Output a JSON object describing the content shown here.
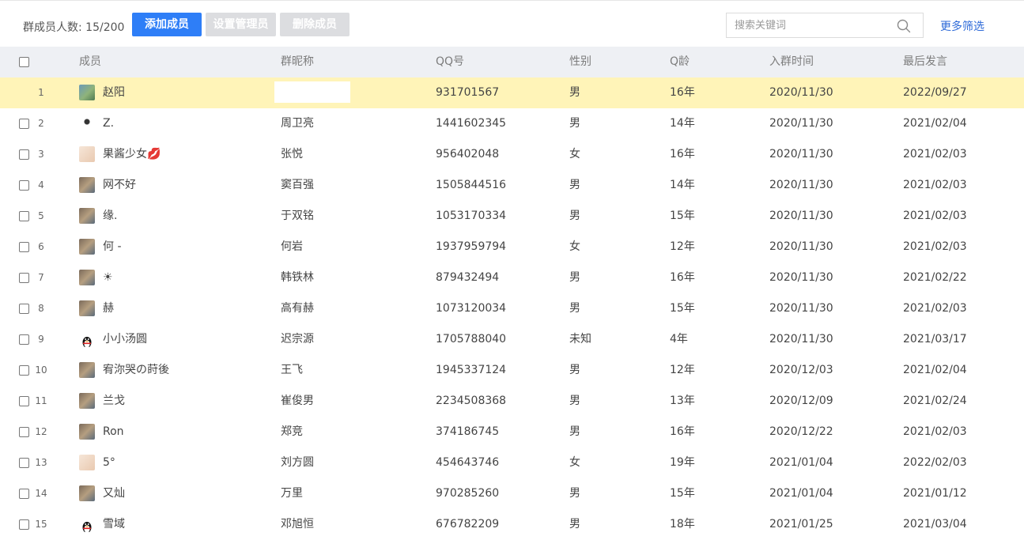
{
  "toolbar": {
    "count_label": "群成员人数: 15/200",
    "add_button": "添加成员",
    "set_admin_button": "设置管理员",
    "delete_button": "删除成员",
    "search_placeholder": "搜索关键词",
    "more_filter": "更多筛选"
  },
  "colors": {
    "primary": "#2e7ef7",
    "disabled": "#dcdde0",
    "highlight_row": "#fff4b8",
    "header_bg": "#eef0f4",
    "link": "#2e6ad8"
  },
  "table": {
    "headers": {
      "member": "成员",
      "nickname": "群昵称",
      "qq": "QQ号",
      "sex": "性别",
      "age": "Q龄",
      "join": "入群时间",
      "last": "最后发言"
    },
    "rows": [
      {
        "idx": "1",
        "avatar": "landscape-avatar",
        "name": "赵阳",
        "nick": "",
        "qq": "931701567",
        "sex": "男",
        "age": "16年",
        "join": "2020/11/30",
        "last": "2022/09/27"
      },
      {
        "idx": "2",
        "avatar": "figure-avatar",
        "name": "Z.",
        "nick": "周卫亮",
        "qq": "1441602345",
        "sex": "男",
        "age": "14年",
        "join": "2020/11/30",
        "last": "2021/02/04"
      },
      {
        "idx": "3",
        "avatar": "cartoon-avatar",
        "name": "果酱少女💋",
        "nick": "张悦",
        "qq": "956402048",
        "sex": "女",
        "age": "16年",
        "join": "2020/11/30",
        "last": "2021/02/03"
      },
      {
        "idx": "4",
        "avatar": "photo-avatar",
        "name": "网不好",
        "nick": "窦百强",
        "qq": "1505844516",
        "sex": "男",
        "age": "14年",
        "join": "2020/11/30",
        "last": "2021/02/03"
      },
      {
        "idx": "5",
        "avatar": "photo-avatar",
        "name": "缘.",
        "nick": "于双铭",
        "qq": "1053170334",
        "sex": "男",
        "age": "15年",
        "join": "2020/11/30",
        "last": "2021/02/03"
      },
      {
        "idx": "6",
        "avatar": "photo-avatar",
        "name": "何 -",
        "nick": "何岩",
        "qq": "1937959794",
        "sex": "女",
        "age": "12年",
        "join": "2020/11/30",
        "last": "2021/02/03"
      },
      {
        "idx": "7",
        "avatar": "photo-avatar",
        "name": "☀",
        "nick": "韩铁林",
        "qq": "879432494",
        "sex": "男",
        "age": "16年",
        "join": "2020/11/30",
        "last": "2021/02/22"
      },
      {
        "idx": "8",
        "avatar": "photo-avatar",
        "name": "赫",
        "nick": "高有赫",
        "qq": "1073120034",
        "sex": "男",
        "age": "15年",
        "join": "2020/11/30",
        "last": "2021/02/03"
      },
      {
        "idx": "9",
        "avatar": "penguin-avatar",
        "name": "小小汤圆",
        "nick": "迟宗源",
        "qq": "1705788040",
        "sex": "未知",
        "age": "4年",
        "join": "2020/11/30",
        "last": "2021/03/17"
      },
      {
        "idx": "10",
        "avatar": "photo-avatar",
        "name": "宥沵哭の莳後",
        "nick": "王飞",
        "qq": "1945337124",
        "sex": "男",
        "age": "12年",
        "join": "2020/12/03",
        "last": "2021/02/04"
      },
      {
        "idx": "11",
        "avatar": "photo-avatar",
        "name": "兰戈",
        "nick": "崔俊男",
        "qq": "2234508368",
        "sex": "男",
        "age": "13年",
        "join": "2020/12/09",
        "last": "2021/02/24"
      },
      {
        "idx": "12",
        "avatar": "photo-avatar",
        "name": "Ron",
        "nick": "郑竞",
        "qq": "374186745",
        "sex": "男",
        "age": "16年",
        "join": "2020/12/22",
        "last": "2021/02/03"
      },
      {
        "idx": "13",
        "avatar": "cartoon-avatar",
        "name": "5°",
        "nick": "刘方圆",
        "qq": "454643746",
        "sex": "女",
        "age": "19年",
        "join": "2021/01/04",
        "last": "2022/02/03"
      },
      {
        "idx": "14",
        "avatar": "photo-avatar",
        "name": "又灿",
        "nick": "万里",
        "qq": "970285260",
        "sex": "男",
        "age": "15年",
        "join": "2021/01/04",
        "last": "2021/01/12"
      },
      {
        "idx": "15",
        "avatar": "penguin-avatar",
        "name": "雪域",
        "nick": "邓旭恒",
        "qq": "676782209",
        "sex": "男",
        "age": "18年",
        "join": "2021/01/25",
        "last": "2021/03/04"
      }
    ]
  }
}
